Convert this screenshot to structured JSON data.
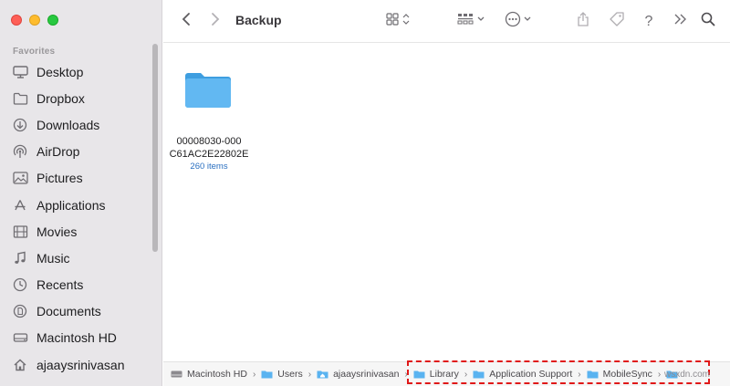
{
  "window": {
    "title": "Backup",
    "traffic_lights": [
      "close",
      "minimize",
      "zoom"
    ]
  },
  "sidebar": {
    "section_title": "Favorites",
    "items": [
      {
        "label": "Desktop",
        "icon": "desktop-icon"
      },
      {
        "label": "Dropbox",
        "icon": "folder-icon"
      },
      {
        "label": "Downloads",
        "icon": "download-icon"
      },
      {
        "label": "AirDrop",
        "icon": "airdrop-icon"
      },
      {
        "label": "Pictures",
        "icon": "pictures-icon"
      },
      {
        "label": "Applications",
        "icon": "applications-icon"
      },
      {
        "label": "Movies",
        "icon": "movies-icon"
      },
      {
        "label": "Music",
        "icon": "music-icon"
      },
      {
        "label": "Recents",
        "icon": "clock-icon"
      },
      {
        "label": "Documents",
        "icon": "document-icon"
      },
      {
        "label": "Macintosh HD",
        "icon": "drive-icon"
      },
      {
        "label": "ajaaysrinivasan",
        "icon": "home-icon"
      }
    ]
  },
  "toolbar": {
    "icons": [
      "back-icon",
      "forward-icon",
      "icon-view-icon",
      "group-icon",
      "more-icon",
      "share-icon",
      "tag-icon",
      "help-icon",
      "overflow-icon",
      "search-icon"
    ],
    "help_label": "?"
  },
  "content": {
    "items": [
      {
        "name_line1": "00008030-000",
        "name_line2": "C61AC2E22802E",
        "count": "260 items",
        "icon": "folder-icon"
      }
    ]
  },
  "pathbar": {
    "crumbs": [
      {
        "label": "Macintosh HD",
        "icon": "drive-icon"
      },
      {
        "label": "Users",
        "icon": "folder-icon"
      },
      {
        "label": "ajaaysrinivasan",
        "icon": "home-icon"
      },
      {
        "label": "Library",
        "icon": "folder-icon"
      },
      {
        "label": "Application Support",
        "icon": "folder-icon"
      },
      {
        "label": "MobileSync",
        "icon": "folder-icon"
      }
    ],
    "separator": "›"
  },
  "watermark": "wsxdn.com",
  "colors": {
    "accent": "#2a6fc0",
    "folder": "#5ab3f0",
    "highlight": "#e01818",
    "sidebar_bg": "#e8e6e9"
  }
}
